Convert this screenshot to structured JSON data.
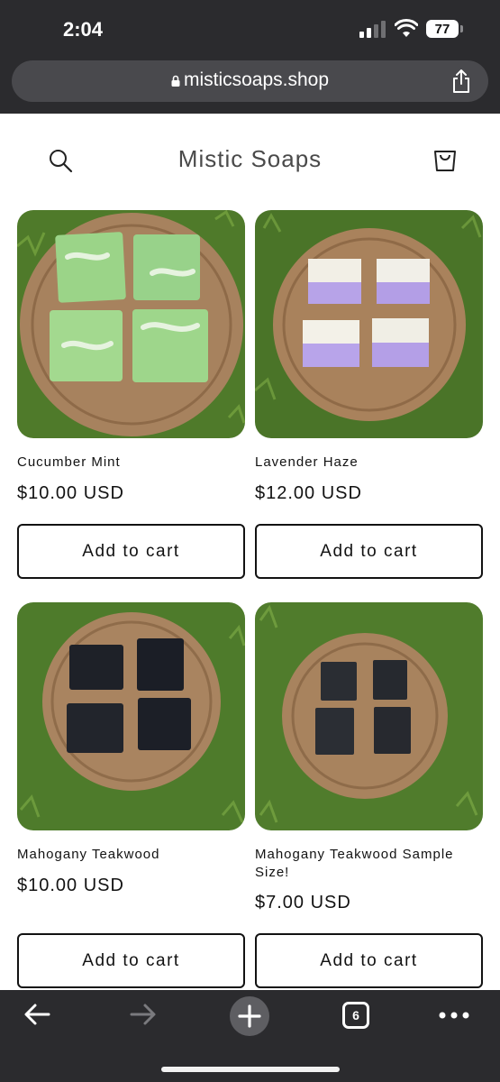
{
  "status_bar": {
    "time": "2:04",
    "battery": "77"
  },
  "browser": {
    "url": "misticsoaps.shop"
  },
  "store": {
    "title": "Mistic Soaps"
  },
  "products": [
    {
      "name": "Cucumber Mint",
      "price": "$10.00 USD",
      "button": "Add to cart"
    },
    {
      "name": "Lavender Haze",
      "price": "$12.00 USD",
      "button": "Add to cart"
    },
    {
      "name": "Mahogany Teakwood",
      "price": "$10.00 USD",
      "button": "Add to cart"
    },
    {
      "name": "Mahogany Teakwood Sample Size!",
      "price": "$7.00 USD",
      "button": "Add to cart"
    }
  ],
  "toolbar": {
    "tab_count": "6"
  },
  "colors": {
    "grass": "#4f7a2a",
    "wood_board": "#a7825e",
    "cucumber_soap": "#9bd488",
    "lavender_soap": "#b7a3e8",
    "charcoal_soap": "#1e2128"
  }
}
